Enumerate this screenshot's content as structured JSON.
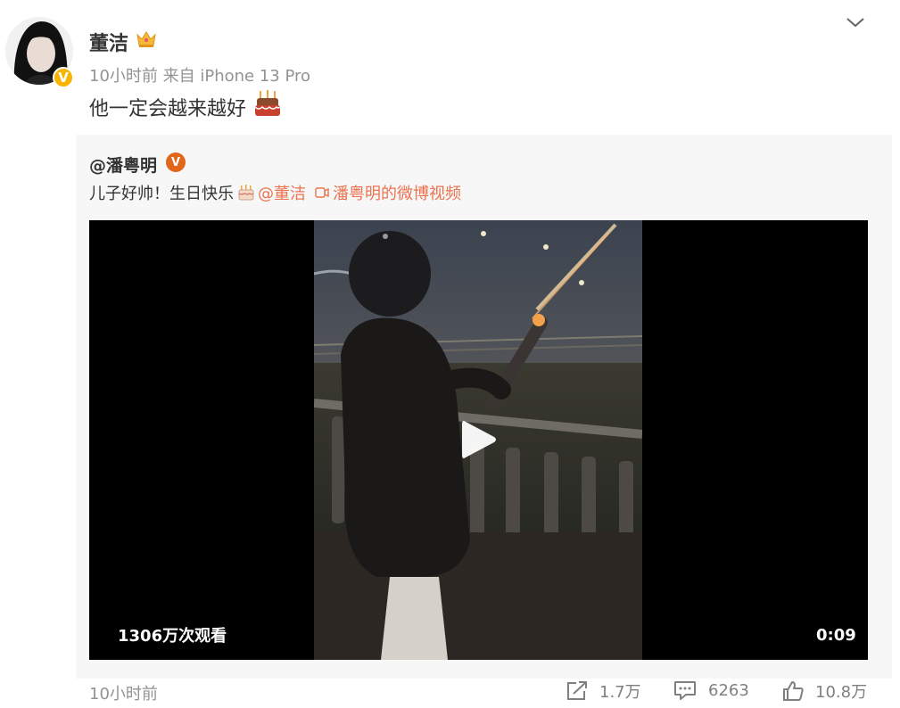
{
  "post": {
    "author": "董洁",
    "time": "10小时前",
    "source": "来自 iPhone 13 Pro",
    "text": "他一定会越来越好",
    "author_badge": "V"
  },
  "repost": {
    "author": "@潘粤明",
    "author_badge": "V",
    "text": "儿子好帅！生日快乐",
    "mention": "@董洁",
    "video_link": "潘粤明的微博视频",
    "video": {
      "views": "1306万次观看",
      "duration": "0:09"
    }
  },
  "footer": {
    "time": "10小时前",
    "share_count": "1.7万",
    "comment_count": "6263",
    "like_count": "10.8万"
  },
  "colors": {
    "link": "#eb7350",
    "muted": "#939393",
    "verified_gold": "#f7b500",
    "verified_orange": "#e0661a"
  },
  "icons": [
    "crown-icon",
    "cake-icon",
    "chevron-down-icon",
    "video-icon",
    "play-icon",
    "share-icon",
    "comment-icon",
    "like-icon"
  ]
}
